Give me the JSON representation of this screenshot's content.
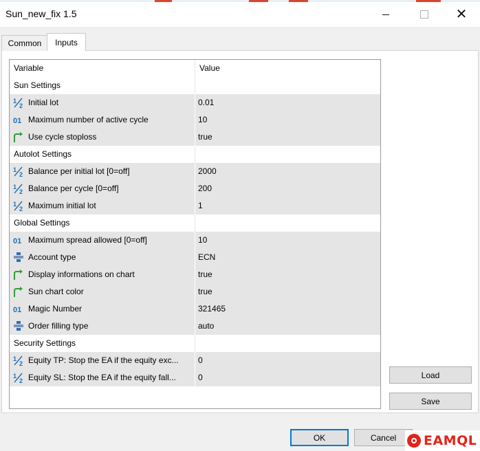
{
  "window": {
    "title": "Sun_new_fix 1.5"
  },
  "tabs": [
    {
      "label": "Common"
    },
    {
      "label": "Inputs"
    }
  ],
  "grid": {
    "header": {
      "variable": "Variable",
      "value": "Value"
    },
    "rows": [
      {
        "kind": "section",
        "name": "Sun Settings",
        "value": ""
      },
      {
        "kind": "param",
        "icon": "fraction-icon",
        "name": "Initial lot",
        "value": "0.01"
      },
      {
        "kind": "param",
        "icon": "integer-icon",
        "name": "Maximum number of active cycle",
        "value": "10"
      },
      {
        "kind": "param",
        "icon": "bool-arrow-icon",
        "name": "Use cycle stoploss",
        "value": "true"
      },
      {
        "kind": "section",
        "name": "Autolot Settings",
        "value": ""
      },
      {
        "kind": "param",
        "icon": "fraction-icon",
        "name": "Balance per initial lot [0=off]",
        "value": "2000"
      },
      {
        "kind": "param",
        "icon": "fraction-icon",
        "name": "Balance per cycle [0=off]",
        "value": "200"
      },
      {
        "kind": "param",
        "icon": "fraction-icon",
        "name": "Maximum initial lot",
        "value": "1"
      },
      {
        "kind": "section",
        "name": "Global Settings",
        "value": ""
      },
      {
        "kind": "param",
        "icon": "integer-icon",
        "name": "Maximum spread allowed [0=off]",
        "value": "10"
      },
      {
        "kind": "param",
        "icon": "enum-icon",
        "name": "Account type",
        "value": "ECN"
      },
      {
        "kind": "param",
        "icon": "bool-arrow-icon",
        "name": "Display informations on chart",
        "value": "true"
      },
      {
        "kind": "param",
        "icon": "bool-arrow-icon",
        "name": "Sun chart color",
        "value": "true"
      },
      {
        "kind": "param",
        "icon": "integer-icon",
        "name": "Magic Number",
        "value": "321465"
      },
      {
        "kind": "param",
        "icon": "enum-icon",
        "name": "Order filling type",
        "value": "auto"
      },
      {
        "kind": "section",
        "name": "Security Settings",
        "value": ""
      },
      {
        "kind": "param",
        "icon": "fraction-icon",
        "name": "Equity TP: Stop the EA if the equity exc...",
        "value": "0"
      },
      {
        "kind": "param",
        "icon": "fraction-icon",
        "name": "Equity SL: Stop the EA if the equity fall...",
        "value": "0"
      }
    ]
  },
  "buttons": {
    "load": "Load",
    "save": "Save",
    "ok": "OK",
    "cancel": "Cancel"
  },
  "watermark": {
    "text": "EAMQL"
  },
  "colors": {
    "accent_red": "#d9452f",
    "focus_blue": "#0078d7",
    "row_shade": "#e5e5e5",
    "logo_red": "#e2231a"
  }
}
